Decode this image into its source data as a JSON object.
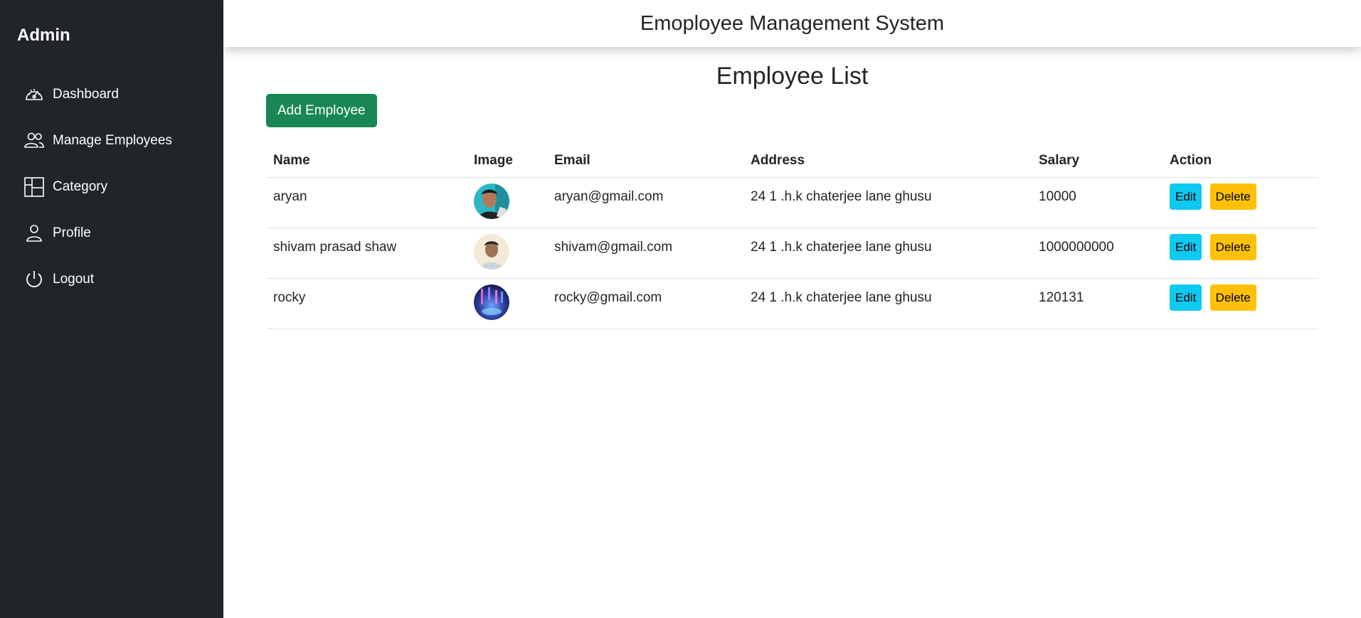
{
  "sidebar": {
    "brand": "Admin",
    "items": [
      {
        "label": "Dashboard",
        "icon": "speedometer-icon"
      },
      {
        "label": "Manage Employees",
        "icon": "people-icon"
      },
      {
        "label": "Category",
        "icon": "columns-icon"
      },
      {
        "label": "Profile",
        "icon": "person-icon"
      },
      {
        "label": "Logout",
        "icon": "power-icon"
      }
    ]
  },
  "header": {
    "title": "Emoployee Management System"
  },
  "main": {
    "page_title": "Employee List",
    "add_button_label": "Add Employee",
    "table": {
      "columns": [
        "Name",
        "Image",
        "Email",
        "Address",
        "Salary",
        "Action"
      ],
      "rows": [
        {
          "name": "aryan",
          "email": "aryan@gmail.com",
          "address": "24 1 .h.k chaterjee lane ghusu",
          "salary": "10000",
          "edit_label": "Edit",
          "delete_label": "Delete"
        },
        {
          "name": "shivam prasad shaw",
          "email": "shivam@gmail.com",
          "address": "24 1 .h.k chaterjee lane ghusu",
          "salary": "1000000000",
          "edit_label": "Edit",
          "delete_label": "Delete"
        },
        {
          "name": "rocky",
          "email": "rocky@gmail.com",
          "address": "24 1 .h.k chaterjee lane ghusu",
          "salary": "120131",
          "edit_label": "Edit",
          "delete_label": "Delete"
        }
      ]
    }
  },
  "colors": {
    "sidebar_bg": "#212529",
    "add_button": "#198754",
    "edit_button": "#0dcaf0",
    "delete_button": "#ffc107"
  }
}
